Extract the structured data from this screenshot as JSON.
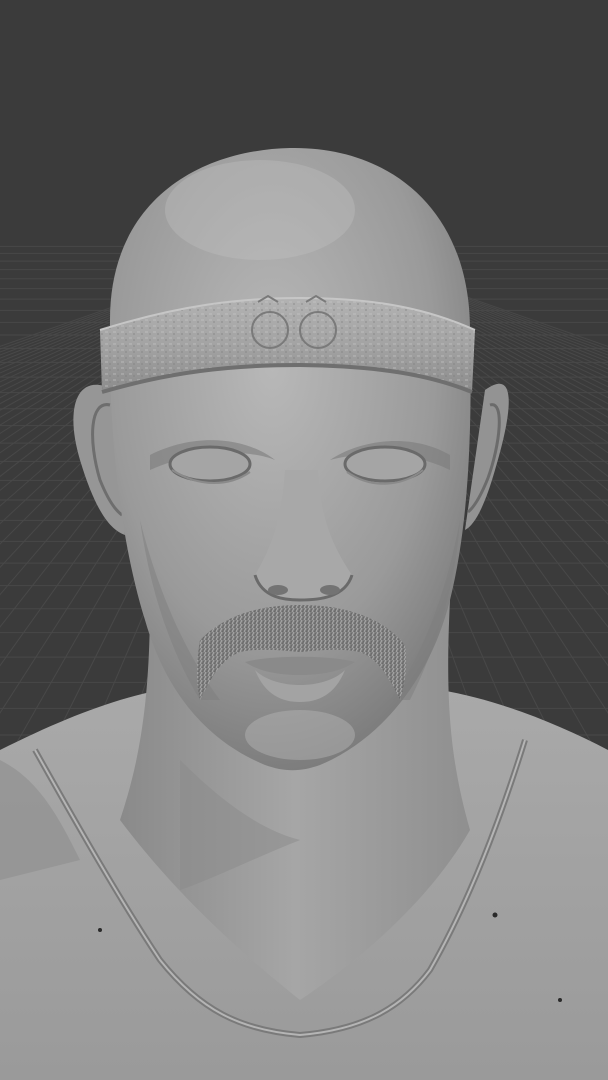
{
  "scene": {
    "background_color": "#3b3b3b",
    "grid_line_color": "#4a4a4a",
    "model_base_color": "#9c9c9c",
    "model_shadow_color": "#6e6e6e",
    "model_highlight_color": "#bdbdbd",
    "headband_color": "#a8a8a8",
    "mustache_color": "#8a8a8a",
    "content": [
      "viewport-grid-floor-icon",
      "sculpted-head-bust-icon"
    ]
  }
}
